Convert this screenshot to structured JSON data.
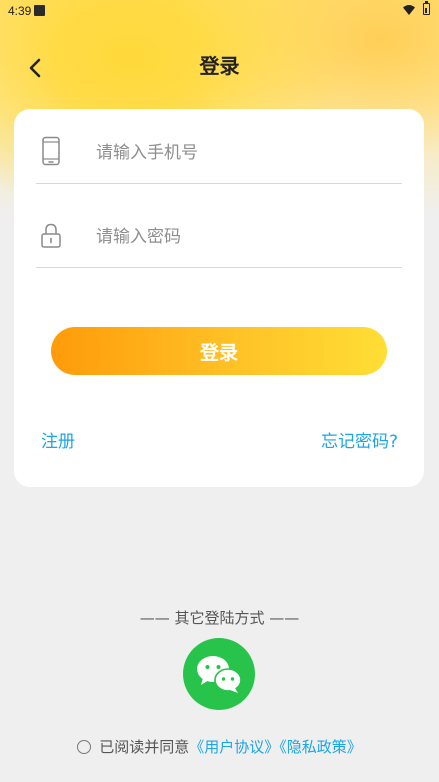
{
  "status_bar": {
    "time": "4:39"
  },
  "header": {
    "title": "登录",
    "back_icon": "chevron-left-icon"
  },
  "form": {
    "phone_placeholder": "请输入手机号",
    "phone_value": "",
    "password_placeholder": "请输入密码",
    "password_value": "",
    "phone_icon": "smartphone-icon",
    "password_icon": "lock-icon",
    "login_label": "登录",
    "register_label": "注册",
    "forgot_label": "忘记密码?"
  },
  "other_login": {
    "title": "—— 其它登陆方式 ——",
    "wechat_icon": "wechat-icon"
  },
  "agreement": {
    "prefix": "已阅读并同意",
    "user_agreement": "《用户协议》",
    "privacy_policy": "《隐私政策》",
    "checked": false
  },
  "colors": {
    "accent": "#ffc227",
    "link": "#1ba6e6",
    "wechat": "#27c34a"
  }
}
